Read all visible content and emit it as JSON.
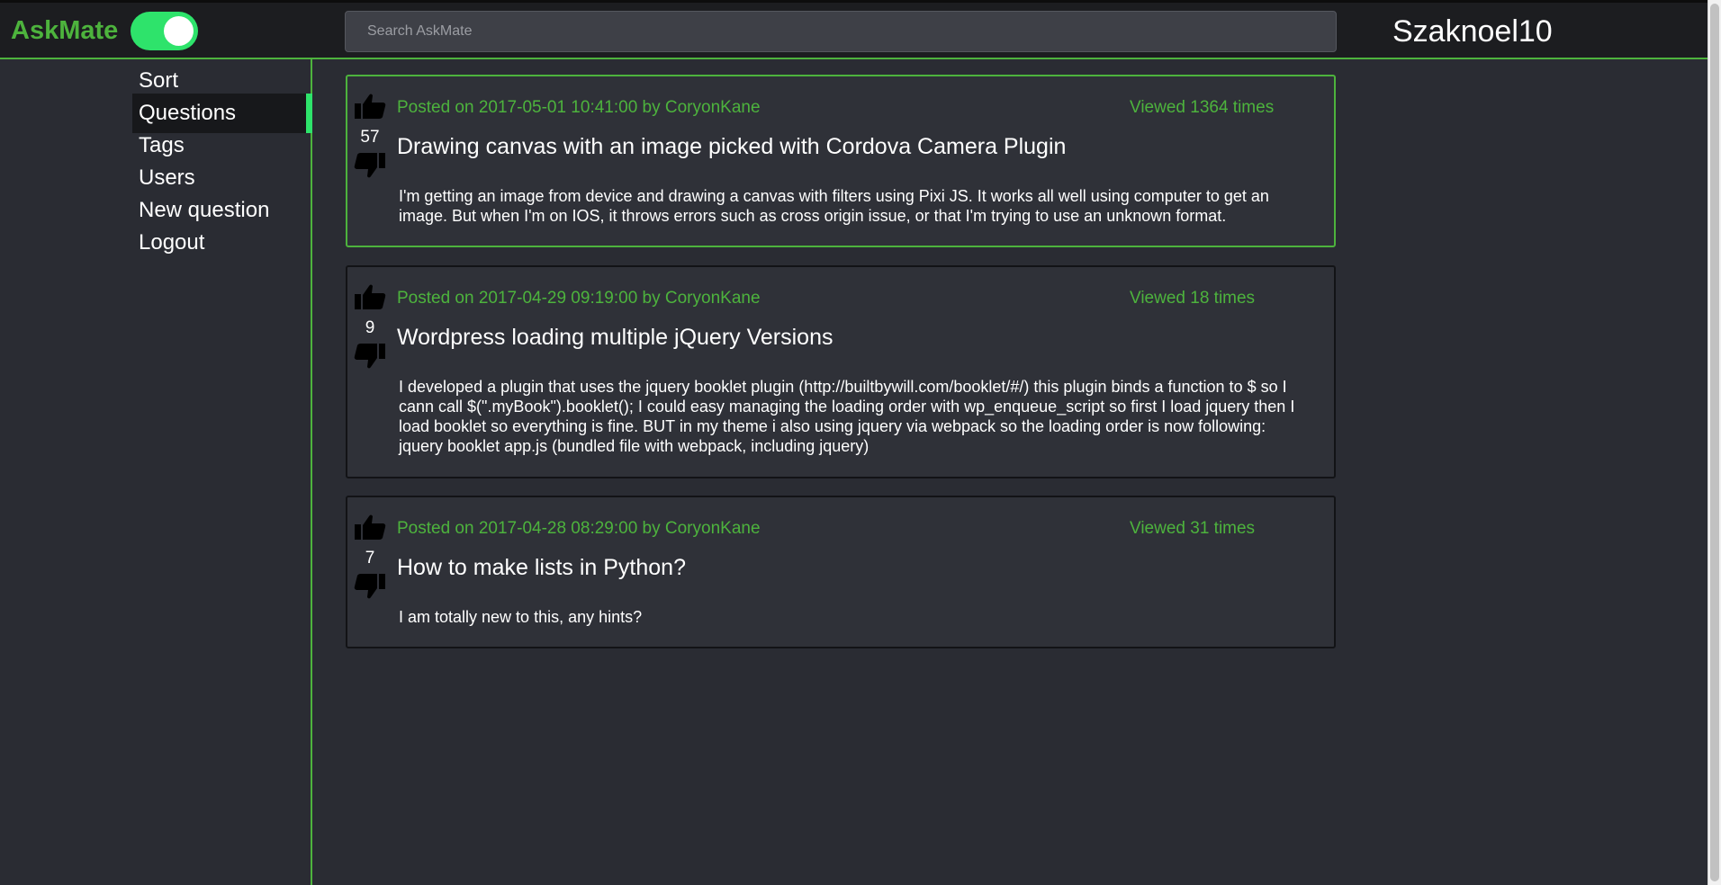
{
  "header": {
    "brand": "AskMate",
    "search_placeholder": "Search AskMate",
    "username": "Szaknoel10"
  },
  "sidebar": {
    "items": [
      {
        "label": "Sort"
      },
      {
        "label": "Questions"
      },
      {
        "label": "Tags"
      },
      {
        "label": "Users"
      },
      {
        "label": "New question"
      },
      {
        "label": "Logout"
      }
    ]
  },
  "questions": [
    {
      "votes": "57",
      "meta": "Posted on 2017-05-01 10:41:00 by CoryonKane",
      "views": "Viewed 1364 times",
      "title": "Drawing canvas with an image picked with Cordova Camera Plugin",
      "body": "I'm getting an image from device and drawing a canvas with filters using Pixi JS. It works all well using computer to get an image. But when I'm on IOS, it throws errors such as cross origin issue, or that I'm trying to use an unknown format."
    },
    {
      "votes": "9",
      "meta": "Posted on 2017-04-29 09:19:00 by CoryonKane",
      "views": "Viewed 18 times",
      "title": "Wordpress loading multiple jQuery Versions",
      "body": "I developed a plugin that uses the jquery booklet plugin (http://builtbywill.com/booklet/#/) this plugin binds a function to $ so I cann call $(\".myBook\").booklet(); I could easy managing the loading order with wp_enqueue_script so first I load jquery then I load booklet so everything is fine. BUT in my theme i also using jquery via webpack so the loading order is now following: jquery booklet app.js (bundled file with webpack, including jquery)"
    },
    {
      "votes": "7",
      "meta": "Posted on 2017-04-28 08:29:00 by CoryonKane",
      "views": "Viewed 31 times",
      "title": "How to make lists in Python?",
      "body": "I am totally new to this, any hints?"
    }
  ],
  "colors": {
    "accent": "#4db33d",
    "toggle": "#2ee36b",
    "background": "#2a2c33",
    "card": "#2f3138"
  },
  "icons": {
    "upvote": "thumbs-up-icon",
    "downvote": "thumbs-down-icon"
  }
}
